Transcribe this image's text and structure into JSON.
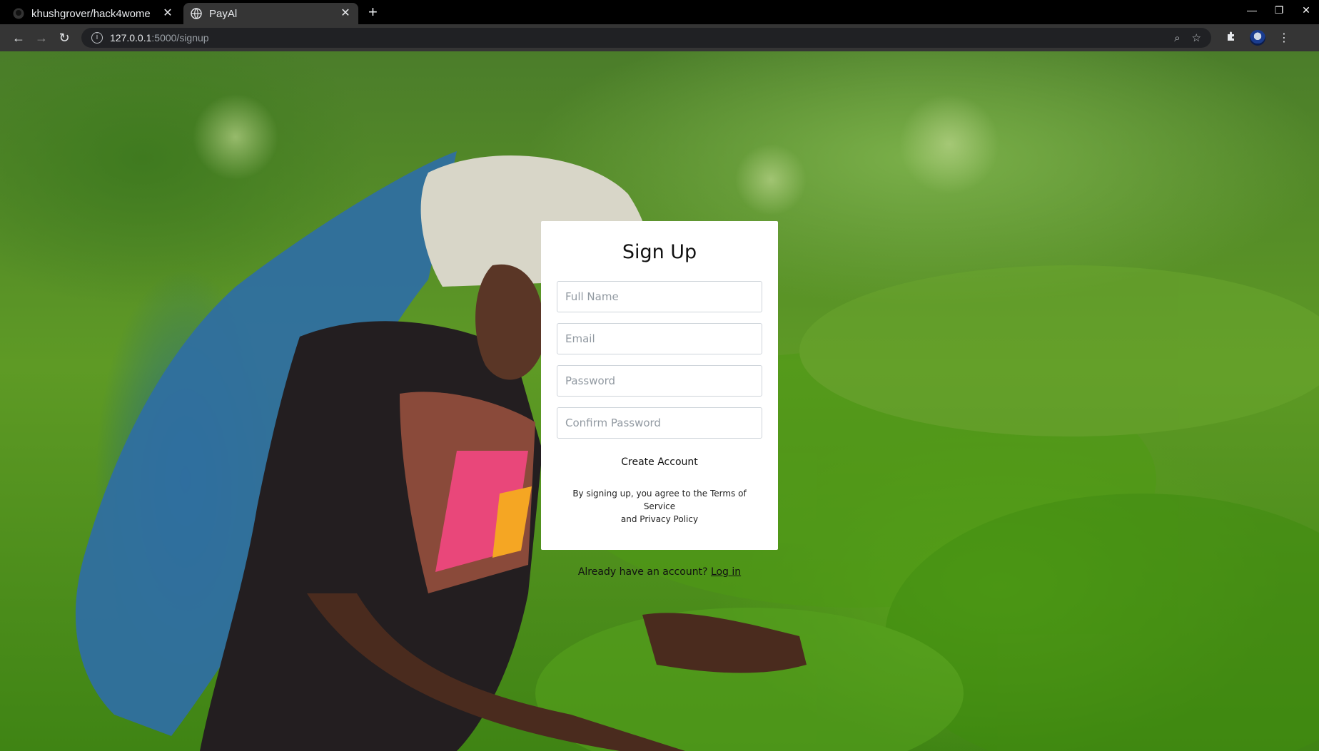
{
  "browser": {
    "tabs": [
      {
        "title": "khushgrover/hack4wome",
        "active": false
      },
      {
        "title": "PayAl",
        "active": true
      }
    ],
    "url_host": "127.0.0.1",
    "url_path": ":5000/signup"
  },
  "signup": {
    "title": "Sign Up",
    "full_name_placeholder": "Full Name",
    "email_placeholder": "Email",
    "password_placeholder": "Password",
    "confirm_password_placeholder": "Confirm Password",
    "create_button": "Create Account",
    "terms_line1": "By signing up, you agree to the Terms of Service",
    "terms_line2": "and Privacy Policy",
    "login_prompt": "Already have an account?",
    "login_link": "Log in"
  },
  "colors": {
    "tab_active": "#353535",
    "titlebar": "#000000",
    "card_bg": "#ffffff"
  }
}
